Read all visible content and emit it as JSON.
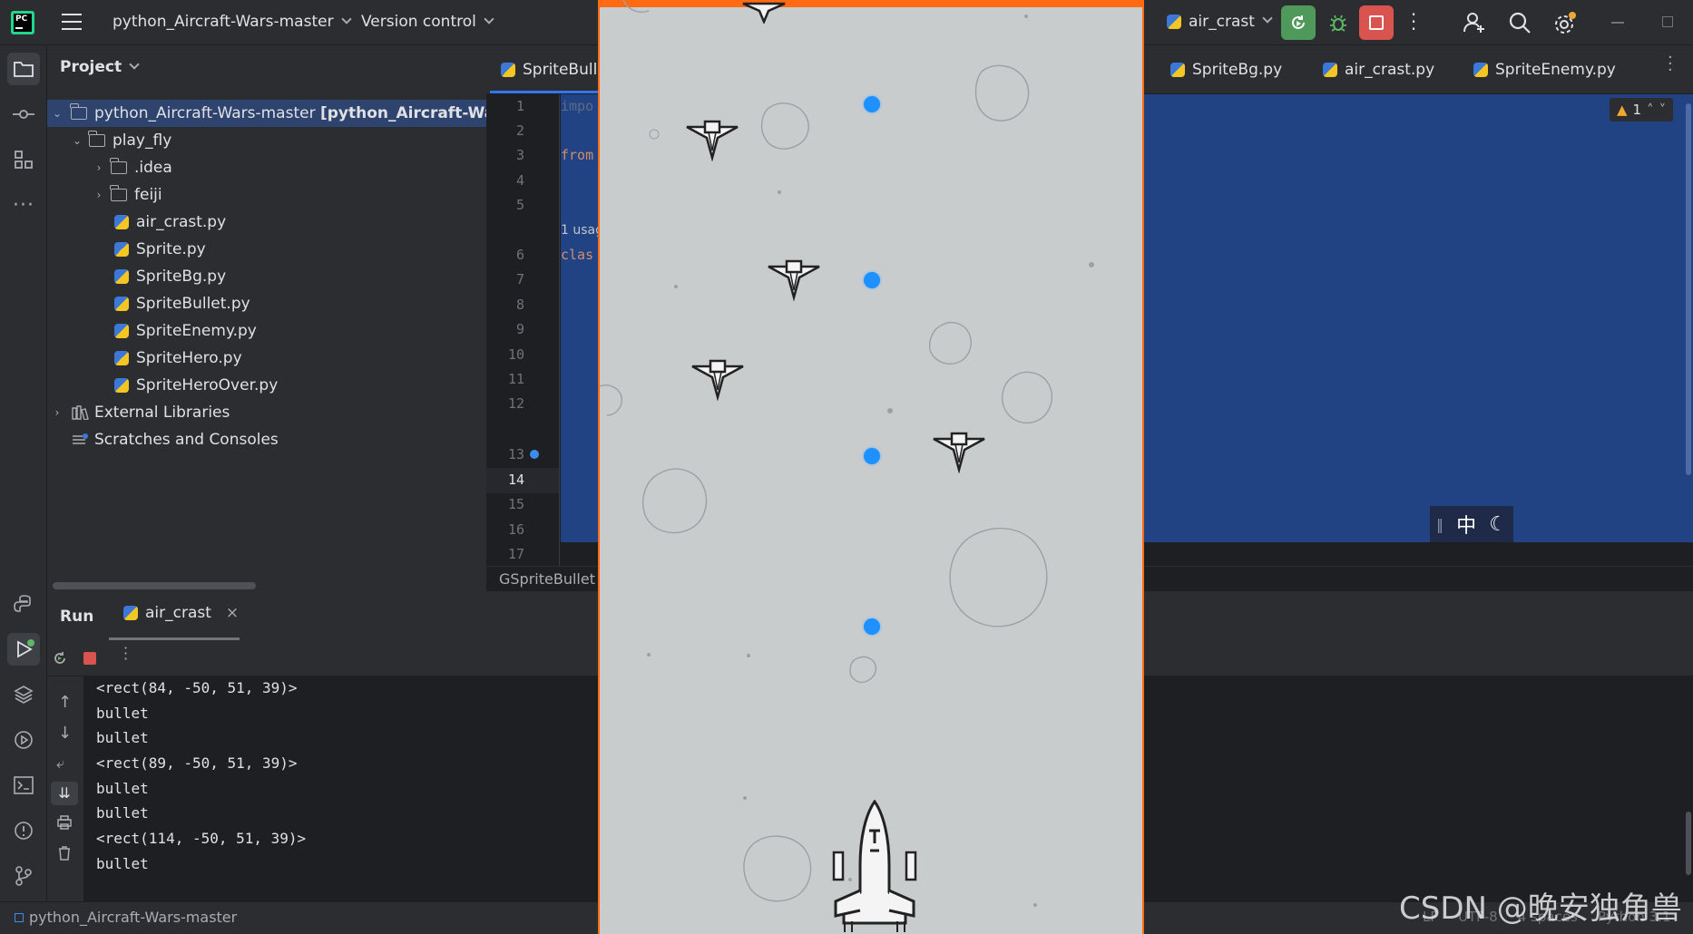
{
  "titlebar": {
    "project_name": "python_Aircraft-Wars-master",
    "vcs_label": "Version control",
    "run_config": "air_crast"
  },
  "project_panel": {
    "title": "Project",
    "root_name": "python_Aircraft-Wars-master",
    "root_module": "[python_Aircraft-Wars]",
    "folder_play_fly": "play_fly",
    "folder_idea": ".idea",
    "folder_feiji": "feiji",
    "files": [
      "air_crast.py",
      "Sprite.py",
      "SpriteBg.py",
      "SpriteBullet.py",
      "SpriteEnemy.py",
      "SpriteHero.py",
      "SpriteHeroOver.py"
    ],
    "external_libraries": "External Libraries",
    "scratches": "Scratches and Consoles"
  },
  "editor": {
    "tabs": [
      "SpriteBulle",
      "SpriteBg.py",
      "air_crast.py",
      "SpriteEnemy.py"
    ],
    "warnings_count": "1",
    "line_numbers": [
      "1",
      "2",
      "3",
      "4",
      "5",
      "6",
      "7",
      "8",
      "9",
      "10",
      "11",
      "12",
      "13",
      "14",
      "15",
      "16",
      "17"
    ],
    "usage_hint": "1 usag",
    "code_fragments": {
      "import": "impo",
      "from": "from",
      "class": "clas"
    },
    "breadcrumb": "GSpriteBullet",
    "ime_char": "中"
  },
  "run_panel": {
    "title": "Run",
    "tab_label": "air_crast",
    "output": [
      "<rect(84, -50, 51, 39)>",
      "bullet",
      "bullet",
      "<rect(89, -50, 51, 39)>",
      "bullet",
      "bullet",
      "<rect(114, -50, 51, 39)>",
      "bullet"
    ]
  },
  "statusbar": {
    "project": "python_Aircraft-Wars-master",
    "line_sep": "LF",
    "encoding": "UTF-8",
    "indent": "4 spaces",
    "interpreter": "Python 3.1"
  },
  "watermark": "CSDN @晚安独角兽",
  "colors": {
    "ide_bg": "#1e1f22",
    "panel_bg": "#2b2d30",
    "selection": "#214283",
    "game_border": "#ff6a13",
    "game_bg": "#c9cccd",
    "bullet": "#1e90ff",
    "run_button": "#4f9a5a",
    "stop_button": "#d9534f"
  }
}
